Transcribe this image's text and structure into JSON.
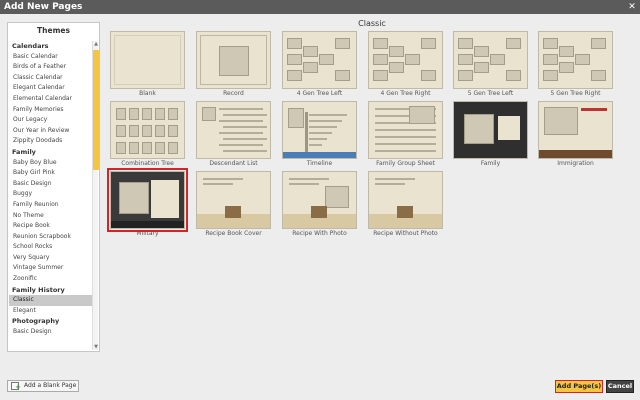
{
  "window": {
    "title": "Add New Pages"
  },
  "sidebar": {
    "title": "Themes",
    "groups": [
      {
        "name": "Calendars",
        "items": [
          "Basic Calendar",
          "Birds of a Feather",
          "Classic Calendar",
          "Elegant Calendar",
          "Elemental Calendar",
          "Family Memories",
          "Our Legacy",
          "Our Year in Review",
          "Zippity Doodads"
        ]
      },
      {
        "name": "Family",
        "items": [
          "Baby Boy Blue",
          "Baby Girl Pink",
          "Basic Design",
          "Buggy",
          "Family Reunion",
          "No Theme",
          "Recipe Book",
          "Reunion Scrapbook",
          "School Rocks",
          "Very Squary",
          "Vintage Summer",
          "Zoonific"
        ]
      },
      {
        "name": "Family History",
        "items": [
          "Classic",
          "Elegant"
        ]
      },
      {
        "name": "Photography",
        "items": [
          "Basic Design"
        ]
      }
    ],
    "selected": "Classic"
  },
  "main": {
    "title": "Classic",
    "tiles": [
      {
        "label": "Blank",
        "style": "blank"
      },
      {
        "label": "Record",
        "style": "record"
      },
      {
        "label": "4 Gen Tree Left",
        "style": "tree"
      },
      {
        "label": "4 Gen Tree Right",
        "style": "tree"
      },
      {
        "label": "5 Gen Tree Left",
        "style": "tree"
      },
      {
        "label": "5 Gen Tree Right",
        "style": "tree"
      },
      {
        "label": "Combination Tree",
        "style": "combo"
      },
      {
        "label": "Descendant List",
        "style": "desc"
      },
      {
        "label": "Timeline",
        "style": "timeline"
      },
      {
        "label": "Family Group Sheet",
        "style": "group"
      },
      {
        "label": "Family",
        "style": "family"
      },
      {
        "label": "Immigration",
        "style": "immig"
      },
      {
        "label": "Military",
        "style": "military"
      },
      {
        "label": "Recipe Book Cover",
        "style": "recipe"
      },
      {
        "label": "Recipe With Photo",
        "style": "recipephoto"
      },
      {
        "label": "Recipe Without Photo",
        "style": "recipe2"
      }
    ],
    "selected": "Military"
  },
  "buttons": {
    "add_blank": "Add a Blank Page",
    "add_pages": "Add Page(s)",
    "cancel": "Cancel"
  },
  "colors": {
    "accent": "#f4c542",
    "selection": "#d6232a",
    "paper": "#eae3cf"
  }
}
